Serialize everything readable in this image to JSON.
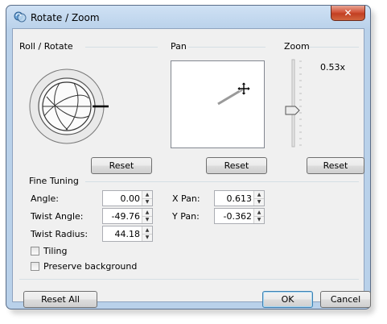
{
  "window": {
    "title": "Rotate / Zoom",
    "close_glyph": "✕"
  },
  "groups": {
    "roll_rotate": "Roll / Rotate",
    "pan": "Pan",
    "zoom": "Zoom",
    "fine_tuning": "Fine Tuning"
  },
  "zoom": {
    "value_text": "0.53x"
  },
  "buttons": {
    "reset_roll": "Reset",
    "reset_pan": "Reset",
    "reset_zoom": "Reset",
    "reset_all": "Reset All",
    "ok": "OK",
    "cancel": "Cancel"
  },
  "fine_tuning": {
    "angle_label": "Angle:",
    "angle_value": "0.00",
    "twist_angle_label": "Twist Angle:",
    "twist_angle_value": "-49.76",
    "twist_radius_label": "Twist Radius:",
    "twist_radius_value": "44.18",
    "x_pan_label": "X Pan:",
    "x_pan_value": "0.613",
    "y_pan_label": "Y Pan:",
    "y_pan_value": "-0.362"
  },
  "checkboxes": {
    "tiling": {
      "label": "Tiling",
      "checked": false
    },
    "preserve_background": {
      "label": "Preserve background",
      "checked": false
    }
  },
  "icons": {
    "app": "rotate-zoom-app-icon",
    "close": "close-icon",
    "spin_up": "spin-up-arrow-icon",
    "spin_down": "spin-down-arrow-icon",
    "move_cursor": "move-cursor-icon"
  },
  "colors": {
    "titlebar": "#b9d1ea",
    "client": "#f0f0f0",
    "close_button": "#c7452a"
  }
}
